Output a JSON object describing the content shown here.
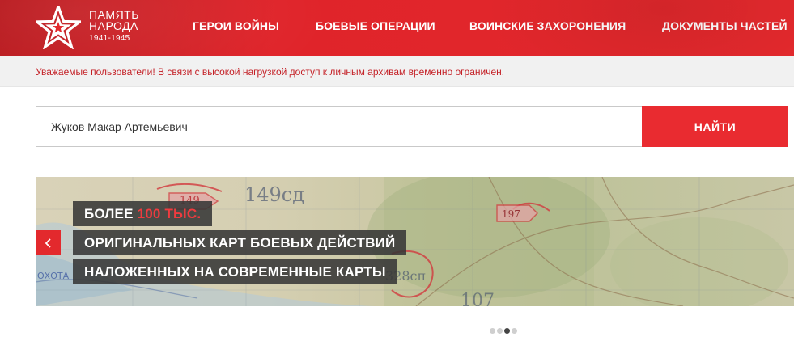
{
  "header": {
    "logo": {
      "line1": "ПАМЯТЬ",
      "line2": "НАРОДА",
      "years": "1941-1945",
      "icon": "star-icon"
    },
    "nav": [
      {
        "label": "ГЕРОИ ВОЙНЫ"
      },
      {
        "label": "БОЕВЫЕ ОПЕРАЦИИ"
      },
      {
        "label": "ВОИНСКИЕ ЗАХОРОНЕНИЯ"
      },
      {
        "label": "ДОКУМЕНТЫ ЧАСТЕЙ"
      }
    ],
    "colors": {
      "brand": "#e3292d",
      "brand_dark": "#b8161b"
    }
  },
  "notice": {
    "text": "Уважаемые пользователи! В связи с высокой нагрузкой доступ к личным архивам временно ограничен.",
    "color": "#c42127"
  },
  "search": {
    "value": "Жуков Макар Артемьевич",
    "placeholder": "",
    "button_label": "НАЙТИ"
  },
  "banner": {
    "line1_prefix": "БОЛЕЕ ",
    "line1_highlight": "100 ТЫС.",
    "line2": "ОРИГИНАЛЬНЫХ КАРТ БОЕВЫХ ДЕЙСТВИЙ",
    "line3": "НАЛОЖЕННЫХ НА СОВРЕМЕННЫЕ КАРТЫ",
    "map_labels": {
      "unit_149": "149",
      "unit_149sd": "149сд",
      "unit_197": "197",
      "unit_328": "328сп",
      "unit_107": "107",
      "place_okhota": "ОХОТА"
    },
    "prev_icon": "chevron-left-icon"
  },
  "carousel": {
    "total_slides": 4,
    "active_index": 2
  }
}
